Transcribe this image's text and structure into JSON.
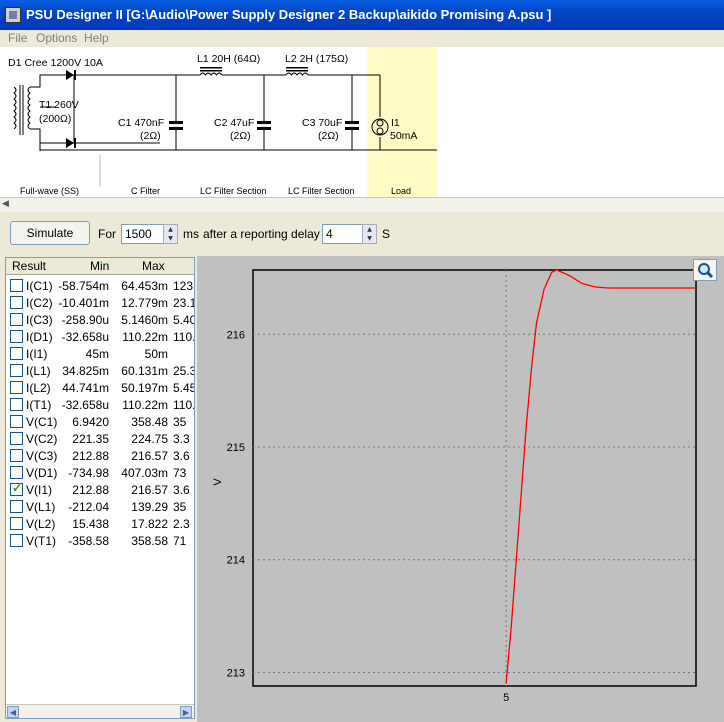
{
  "window": {
    "title": "PSU Designer II  [G:\\Audio\\Power Supply Designer 2 Backup\\aikido Promising A.psu ]"
  },
  "menu": [
    "File",
    "Options",
    "Help"
  ],
  "schematic": {
    "diode_label": "D1 Cree 1200V 10A",
    "transformer_label": "T1 260V",
    "transformer_res": "(200Ω)",
    "c1_label": "C1 470nF",
    "c1_res": "(2Ω)",
    "l1_label": "L1 20H (64Ω)",
    "c2_label": "C2 47uF",
    "c2_res": "(2Ω)",
    "l2_label": "L2 2H (175Ω)",
    "c3_label": "C3 70uF",
    "c3_res": "(2Ω)",
    "load_label": "I1",
    "load_value": "50mA",
    "sections": [
      "Full-wave (SS)",
      "C Filter",
      "LC Filter Section",
      "LC Filter Section",
      "Load"
    ],
    "load_highlight": "#fffbc5"
  },
  "simulate": {
    "button": "Simulate",
    "for_label": "For",
    "duration": "1500",
    "ms_label": "ms",
    "delay_label": "after a reporting delay of",
    "delay": "4",
    "s_label": "S"
  },
  "results": {
    "headers": [
      "Result",
      "Min",
      "Max"
    ],
    "rows": [
      {
        "name": "I(C1)",
        "min": "-58.754m",
        "max": "64.453m",
        "extra": "123.",
        "checked": false
      },
      {
        "name": "I(C2)",
        "min": "-10.401m",
        "max": "12.779m",
        "extra": "23.1",
        "checked": false
      },
      {
        "name": "I(C3)",
        "min": "-258.90u",
        "max": "5.1460m",
        "extra": "5.40",
        "checked": false
      },
      {
        "name": "I(D1)",
        "min": "-32.658u",
        "max": "110.22m",
        "extra": "110.",
        "checked": false
      },
      {
        "name": "I(I1)",
        "min": "45m",
        "max": "50m",
        "extra": "",
        "checked": false
      },
      {
        "name": "I(L1)",
        "min": "34.825m",
        "max": "60.131m",
        "extra": "25.3",
        "checked": false
      },
      {
        "name": "I(L2)",
        "min": "44.741m",
        "max": "50.197m",
        "extra": "5.45",
        "checked": false
      },
      {
        "name": "I(T1)",
        "min": "-32.658u",
        "max": "110.22m",
        "extra": "110.",
        "checked": false
      },
      {
        "name": "V(C1)",
        "min": "6.9420",
        "max": "358.48",
        "extra": "35",
        "checked": false
      },
      {
        "name": "V(C2)",
        "min": "221.35",
        "max": "224.75",
        "extra": "3.3",
        "checked": false
      },
      {
        "name": "V(C3)",
        "min": "212.88",
        "max": "216.57",
        "extra": "3.6",
        "checked": false
      },
      {
        "name": "V(D1)",
        "min": "-734.98",
        "max": "407.03m",
        "extra": "73",
        "checked": false
      },
      {
        "name": "V(I1)",
        "min": "212.88",
        "max": "216.57",
        "extra": "3.6",
        "checked": true
      },
      {
        "name": "V(L1)",
        "min": "-212.04",
        "max": "139.29",
        "extra": "35",
        "checked": false
      },
      {
        "name": "V(L2)",
        "min": "15.438",
        "max": "17.822",
        "extra": "2.3",
        "checked": false
      },
      {
        "name": "V(T1)",
        "min": "-358.58",
        "max": "358.58",
        "extra": "71",
        "checked": false
      }
    ]
  },
  "chart_data": {
    "type": "line",
    "ylabel": "V",
    "xlabel": "",
    "yticks": [
      213,
      214,
      215,
      216
    ],
    "xticks": [
      5
    ],
    "ylim": [
      212.88,
      216.57
    ],
    "xlim": [
      4,
      5.75
    ],
    "grid": true,
    "line_color": "#ff0000",
    "series": [
      {
        "x": [
          5.0,
          5.02,
          5.05,
          5.08,
          5.1,
          5.12,
          5.15,
          5.18,
          5.2,
          5.25,
          5.3,
          5.35,
          5.4,
          5.5,
          5.6,
          5.7,
          5.75
        ],
        "y": [
          212.9,
          213.4,
          214.3,
          215.2,
          215.7,
          216.1,
          216.4,
          216.55,
          216.57,
          216.52,
          216.45,
          216.42,
          216.41,
          216.41,
          216.41,
          216.41,
          216.41
        ]
      }
    ]
  }
}
